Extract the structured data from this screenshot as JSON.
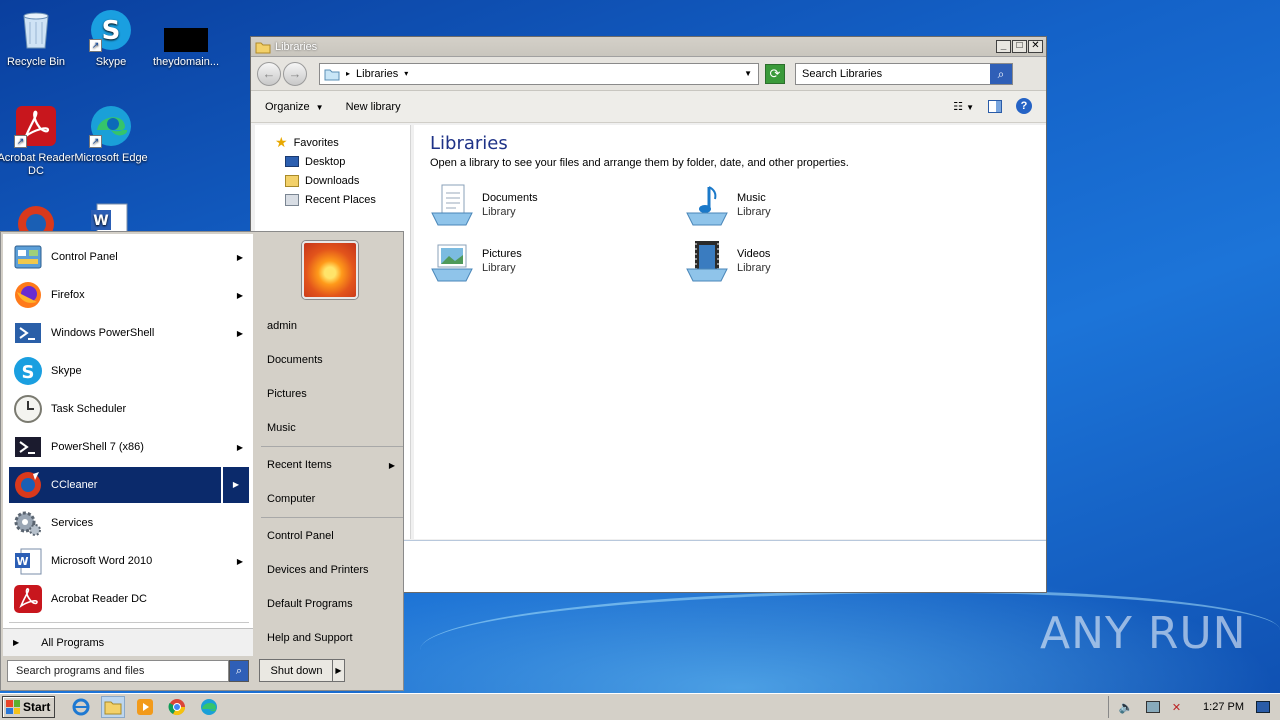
{
  "desktop": {
    "icons": [
      {
        "label": "Recycle Bin"
      },
      {
        "label": "Skype"
      },
      {
        "label": "theydomain..."
      },
      {
        "label": "Acrobat Reader DC"
      },
      {
        "label": "Microsoft Edge"
      }
    ],
    "watermark": "ANY RUN"
  },
  "explorer": {
    "title": "Libraries",
    "address": "Libraries",
    "search_placeholder": "Search Libraries",
    "commands": {
      "organize": "Organize",
      "new_library": "New library"
    },
    "nav": {
      "favorites": "Favorites",
      "items": [
        "Desktop",
        "Downloads",
        "Recent Places"
      ]
    },
    "heading": "Libraries",
    "description": "Open a library to see your files and arrange them by folder, date, and other properties.",
    "libraries": [
      {
        "name": "Documents",
        "type": "Library",
        "icon": "documents-library-icon"
      },
      {
        "name": "Music",
        "type": "Library",
        "icon": "music-library-icon"
      },
      {
        "name": "Pictures",
        "type": "Library",
        "icon": "pictures-library-icon"
      },
      {
        "name": "Videos",
        "type": "Library",
        "icon": "videos-library-icon"
      }
    ]
  },
  "start_menu": {
    "programs": [
      {
        "label": "Control Panel"
      },
      {
        "label": "Firefox"
      },
      {
        "label": "Windows PowerShell"
      },
      {
        "label": "Skype"
      },
      {
        "label": "Task Scheduler"
      },
      {
        "label": "PowerShell 7 (x86)"
      },
      {
        "label": "CCleaner"
      },
      {
        "label": "Services"
      },
      {
        "label": "Microsoft Word 2010"
      },
      {
        "label": "Acrobat Reader DC"
      }
    ],
    "all_programs": "All Programs",
    "search_placeholder": "Search programs and files",
    "right": {
      "user": "admin",
      "documents": "Documents",
      "pictures": "Pictures",
      "music": "Music",
      "recent_items": "Recent Items",
      "computer": "Computer",
      "control_panel": "Control Panel",
      "devices_printers": "Devices and Printers",
      "default_programs": "Default Programs",
      "help_support": "Help and Support"
    },
    "shutdown": "Shut down"
  },
  "taskbar": {
    "start_label": "Start",
    "clock": "1:27 PM"
  }
}
